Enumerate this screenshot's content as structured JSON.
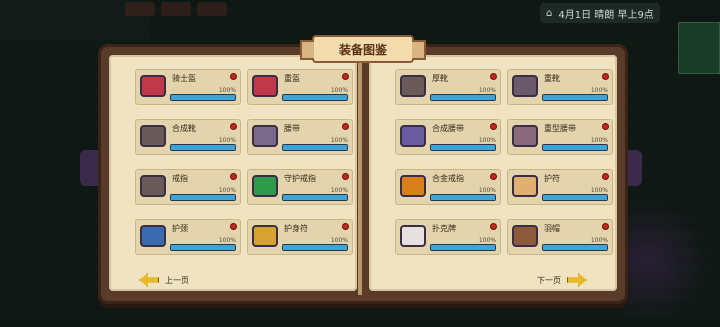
{
  "title": "装备图鉴",
  "hud": {
    "status_text": "4月1日  晴朗  早上9点"
  },
  "nav": {
    "prev_label": "上一页",
    "next_label": "下一页"
  },
  "left_items": [
    {
      "name": "骑士盔",
      "pct": "100%",
      "progress": 1.0,
      "icon": "knight-helmet-icon",
      "color": "#c0394a"
    },
    {
      "name": "重盔",
      "pct": "100%",
      "progress": 1.0,
      "icon": "heavy-helmet-icon",
      "color": "#c0394a"
    },
    {
      "name": "合成靴",
      "pct": "100%",
      "progress": 1.0,
      "icon": "crafted-boots-icon",
      "color": "#6a5a5a"
    },
    {
      "name": "腰带",
      "pct": "100%",
      "progress": 1.0,
      "icon": "belt-icon",
      "color": "#7a6a8a"
    },
    {
      "name": "戒指",
      "pct": "100%",
      "progress": 1.0,
      "icon": "ring-icon",
      "color": "#6a5a5a"
    },
    {
      "name": "守护戒指",
      "pct": "100%",
      "progress": 1.0,
      "icon": "guardian-ring-icon",
      "color": "#2f9a4a"
    },
    {
      "name": "护颈",
      "pct": "100%",
      "progress": 1.0,
      "icon": "neck-guard-icon",
      "color": "#3a6ab0"
    },
    {
      "name": "护身符",
      "pct": "100%",
      "progress": 1.0,
      "icon": "amulet-icon",
      "color": "#d8a230"
    }
  ],
  "right_items": [
    {
      "name": "厚靴",
      "pct": "100%",
      "progress": 1.0,
      "icon": "thick-boots-icon",
      "color": "#6a5a5a"
    },
    {
      "name": "重靴",
      "pct": "100%",
      "progress": 1.0,
      "icon": "heavy-boots-icon",
      "color": "#6a5a6a"
    },
    {
      "name": "合成腰带",
      "pct": "100%",
      "progress": 1.0,
      "icon": "crafted-belt-icon",
      "color": "#6a5aa0"
    },
    {
      "name": "重型腰带",
      "pct": "100%",
      "progress": 1.0,
      "icon": "heavy-belt-icon",
      "color": "#8a6a7a"
    },
    {
      "name": "合金戒指",
      "pct": "100%",
      "progress": 1.0,
      "icon": "alloy-ring-icon",
      "color": "#d8801a"
    },
    {
      "name": "护符",
      "pct": "100%",
      "progress": 1.0,
      "icon": "charm-icon",
      "color": "#e0b070"
    },
    {
      "name": "扑克牌",
      "pct": "100%",
      "progress": 1.0,
      "icon": "playing-card-icon",
      "color": "#e8e0e0"
    },
    {
      "name": "羽帽",
      "pct": "100%",
      "progress": 1.0,
      "icon": "feather-hat-icon",
      "color": "#8a5a3a"
    }
  ]
}
